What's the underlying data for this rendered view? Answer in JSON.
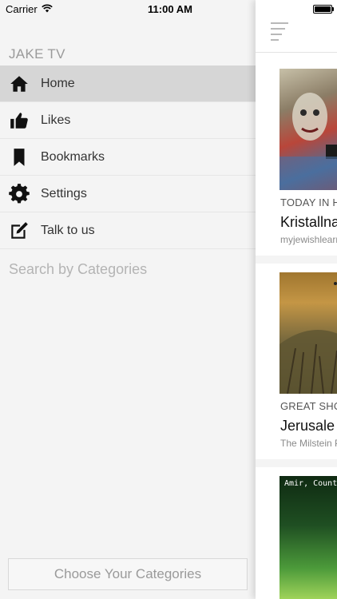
{
  "status_bar": {
    "carrier": "Carrier",
    "time": "11:00 AM"
  },
  "sidebar": {
    "app_title": "JAKE TV",
    "items": [
      {
        "label": "Home",
        "icon": "home-icon",
        "active": true
      },
      {
        "label": "Likes",
        "icon": "thumbs-up-icon",
        "active": false
      },
      {
        "label": "Bookmarks",
        "icon": "bookmark-icon",
        "active": false
      },
      {
        "label": "Settings",
        "icon": "gear-icon",
        "active": false
      },
      {
        "label": "Talk to us",
        "icon": "edit-icon",
        "active": false
      }
    ],
    "search_categories": "Search by Categories",
    "choose_button": "Choose Your Categories"
  },
  "feed": {
    "cards": [
      {
        "category": "TODAY IN H",
        "title": "Kristallna",
        "source": "myjewishlearn"
      },
      {
        "category": "GREAT SHO",
        "title": "Jerusale",
        "source": "The Milstein P"
      },
      {
        "overlay_text": "Amir, Counte"
      }
    ]
  },
  "colors": {
    "active_item_bg": "#d6d6d6",
    "sidebar_bg": "#f4f4f4",
    "muted_text": "#9a9a9a"
  }
}
